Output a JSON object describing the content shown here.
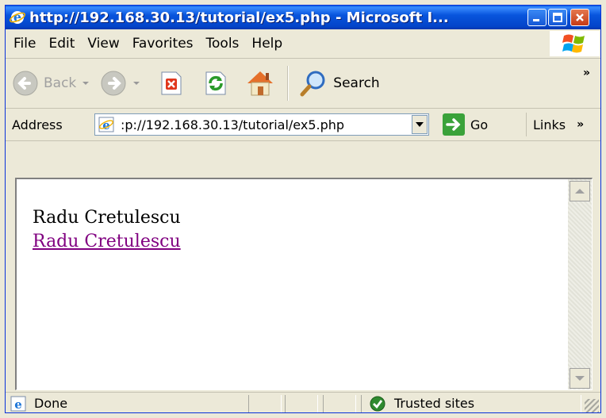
{
  "window": {
    "title": "http://192.168.30.13/tutorial/ex5.php - Microsoft I...",
    "accent_color": "#0344c9"
  },
  "menubar": {
    "items": [
      {
        "label": "File"
      },
      {
        "label": "Edit"
      },
      {
        "label": "View"
      },
      {
        "label": "Favorites"
      },
      {
        "label": "Tools"
      },
      {
        "label": "Help"
      }
    ]
  },
  "toolbar": {
    "back_label": "Back",
    "search_label": "Search",
    "more_label": "»"
  },
  "addressbar": {
    "label": "Address",
    "url": ":p://192.168.30.13/tutorial/ex5.php",
    "go_label": "Go",
    "links_label": "Links",
    "links_more": "»"
  },
  "page": {
    "text_line": "Radu Cretulescu",
    "link_text": "Radu Cretulescu",
    "link_color": "#800080"
  },
  "statusbar": {
    "status_text": "Done",
    "zone_text": "Trusted sites"
  }
}
